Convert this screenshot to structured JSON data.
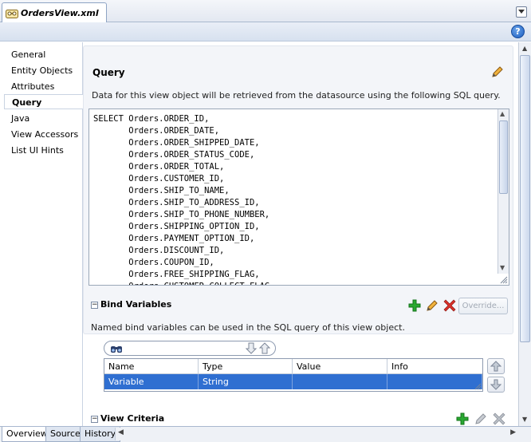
{
  "editor_tab": {
    "title": "OrdersView.xml"
  },
  "help": {
    "label": "?"
  },
  "nav": {
    "items": [
      {
        "label": "General"
      },
      {
        "label": "Entity Objects"
      },
      {
        "label": "Attributes"
      },
      {
        "label": "Query",
        "selected": true
      },
      {
        "label": "Java"
      },
      {
        "label": "View Accessors"
      },
      {
        "label": "List UI Hints"
      }
    ]
  },
  "query": {
    "title": "Query",
    "description": "Data for this view object will be retrieved from the datasource using the following SQL query.",
    "sql_lines": [
      "SELECT Orders.ORDER_ID,",
      "       Orders.ORDER_DATE,",
      "       Orders.ORDER_SHIPPED_DATE,",
      "       Orders.ORDER_STATUS_CODE,",
      "       Orders.ORDER_TOTAL,",
      "       Orders.CUSTOMER_ID,",
      "       Orders.SHIP_TO_NAME,",
      "       Orders.SHIP_TO_ADDRESS_ID,",
      "       Orders.SHIP_TO_PHONE_NUMBER,",
      "       Orders.SHIPPING_OPTION_ID,",
      "       Orders.PAYMENT_OPTION_ID,",
      "       Orders.DISCOUNT_ID,",
      "       Orders.COUPON_ID,",
      "       Orders.FREE_SHIPPING_FLAG,",
      "       Orders.CUSTOMER_COLLECT_FLAG,"
    ]
  },
  "bind_variables": {
    "title": "Bind Variables",
    "override_label": "Override...",
    "description": "Named bind variables can be used in the SQL query of this view object.",
    "columns": [
      "Name",
      "Type",
      "Value",
      "Info"
    ],
    "rows": [
      {
        "name": "Variable",
        "type": "String",
        "value": "",
        "info": ""
      }
    ]
  },
  "view_criteria": {
    "title": "View Criteria"
  },
  "bottom_tabs": [
    {
      "label": "Overview",
      "active": true
    },
    {
      "label": "Source"
    },
    {
      "label": "History"
    }
  ],
  "colors": {
    "selection": "#2f6fd1",
    "add_green": "#1f9d2a",
    "delete_red": "#d0281e",
    "edit_orange": "#e08a1e"
  }
}
